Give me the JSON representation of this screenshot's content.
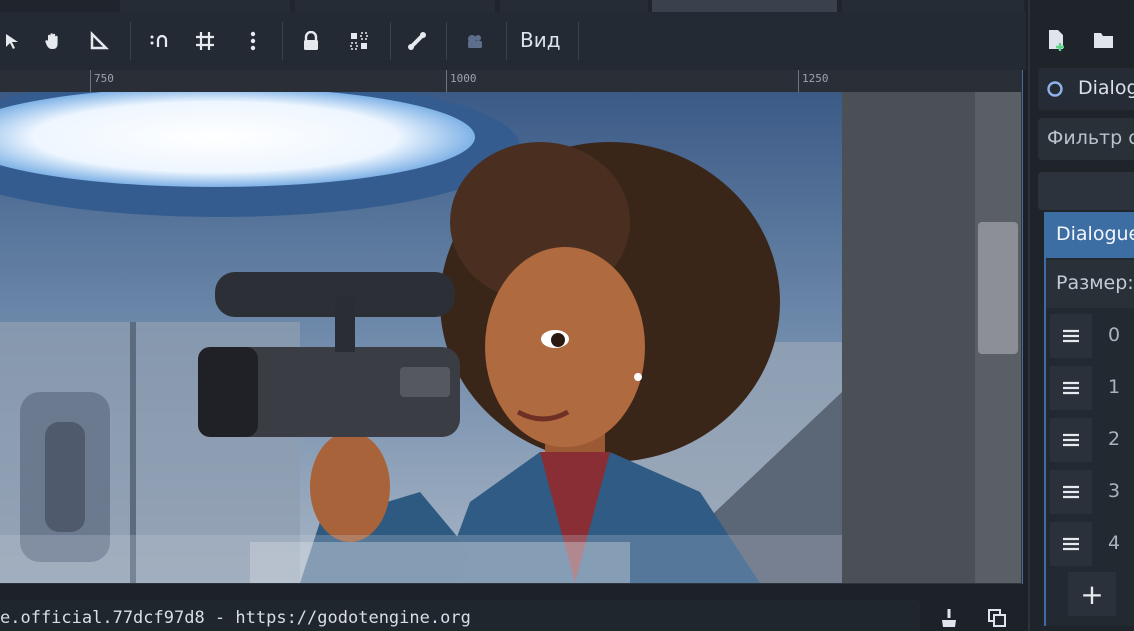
{
  "toolbar": {
    "view_menu_label": "Вид"
  },
  "ruler": {
    "labels": [
      "750",
      "1000",
      "1250"
    ]
  },
  "console": {
    "line": "e.official.77dcf97d8 - https://godotengine.org"
  },
  "dock": {
    "node_name": "Dialog",
    "filter_placeholder": "Фильтр с",
    "section_title": "Dialogue",
    "size_label": "Размер:",
    "items": [
      "0",
      "1",
      "2",
      "3",
      "4"
    ],
    "add_label": "+"
  },
  "colors": {
    "accent": "#4a6a93",
    "selection_header": "#3c6ea3",
    "background": "#1d2229"
  }
}
